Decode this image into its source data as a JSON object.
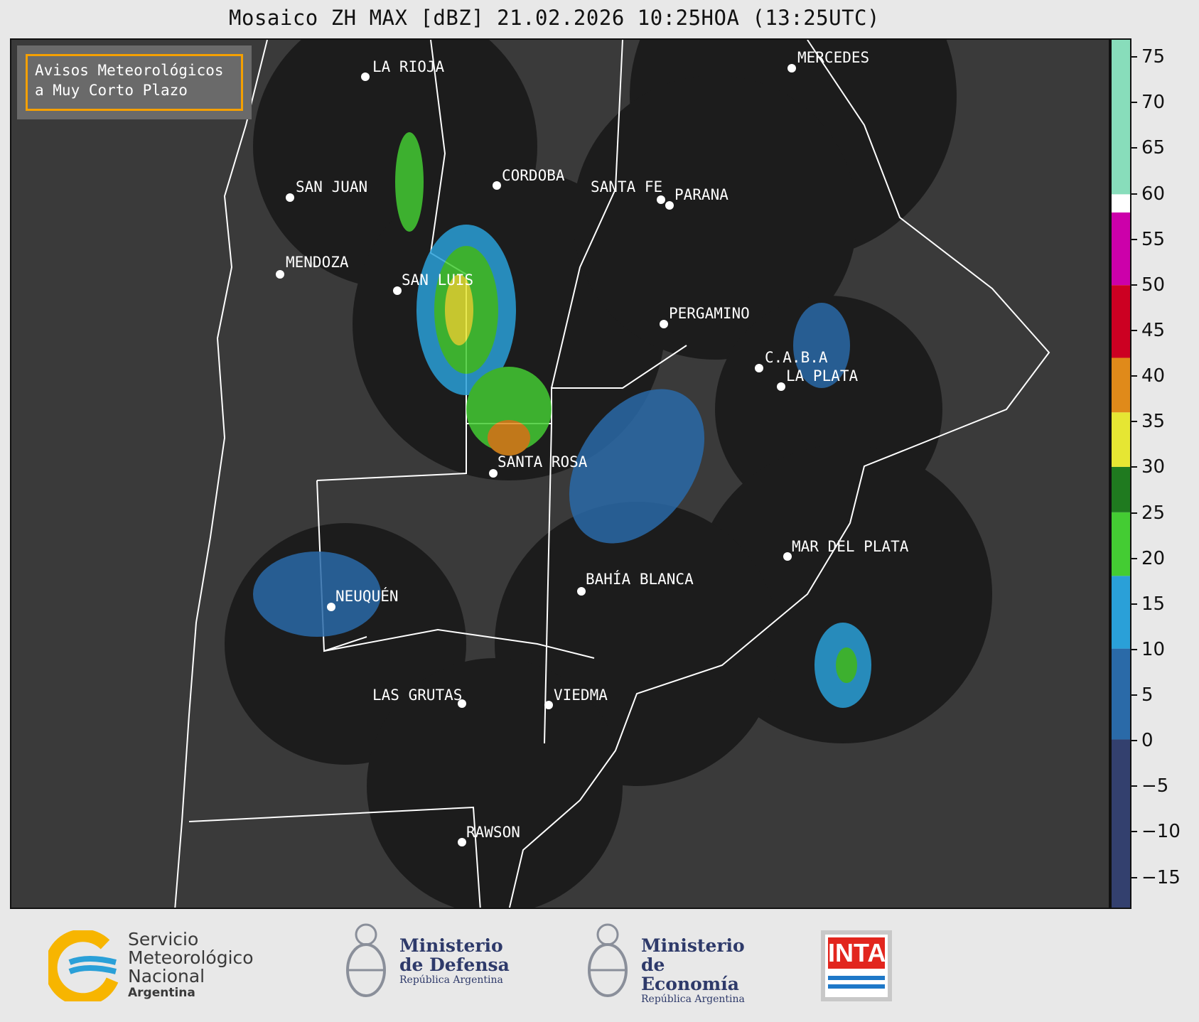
{
  "title": "Mosaico ZH MAX [dBZ] 21.02.2026 10:25HOA (13:25UTC)",
  "notice": {
    "line1": "Avisos Meteorológicos",
    "line2": "a Muy Corto Plazo"
  },
  "colors": {
    "accent_notice_border": "#f5a000",
    "radar_coverage": "#1c1c1c",
    "background": "#3a3a3a"
  },
  "cities": [
    {
      "name": "LA RIOJA"
    },
    {
      "name": "CORDOBA"
    },
    {
      "name": "SAN JUAN"
    },
    {
      "name": "SANTA FE"
    },
    {
      "name": "PARANA"
    },
    {
      "name": "MENDOZA"
    },
    {
      "name": "SAN LUIS"
    },
    {
      "name": "PERGAMINO"
    },
    {
      "name": "C.A.B.A"
    },
    {
      "name": "LA PLATA"
    },
    {
      "name": "MERCEDES"
    },
    {
      "name": "SANTA ROSA"
    },
    {
      "name": "MAR DEL PLATA"
    },
    {
      "name": "NEUQUÉN"
    },
    {
      "name": "BAHÍA BLANCA"
    },
    {
      "name": "LAS GRUTAS"
    },
    {
      "name": "VIEDMA"
    },
    {
      "name": "RAWSON"
    }
  ],
  "colorbar": {
    "min": -18.5,
    "max": 77.0,
    "ticks": [
      "75",
      "70",
      "65",
      "60",
      "55",
      "50",
      "45",
      "40",
      "35",
      "30",
      "25",
      "20",
      "15",
      "10",
      "5",
      "0",
      "−5",
      "−10",
      "−15"
    ],
    "tick_values": [
      75,
      70,
      65,
      60,
      55,
      50,
      45,
      40,
      35,
      30,
      25,
      20,
      15,
      10,
      5,
      0,
      -5,
      -10,
      -15
    ],
    "bands": [
      {
        "from": -18.5,
        "to": 0,
        "color": "#33406e"
      },
      {
        "from": 0,
        "to": 10,
        "color": "#2a6aa8"
      },
      {
        "from": 10,
        "to": 18,
        "color": "#2aa0d8"
      },
      {
        "from": 18,
        "to": 25,
        "color": "#44cc33"
      },
      {
        "from": 25,
        "to": 30,
        "color": "#1f7a1f"
      },
      {
        "from": 30,
        "to": 36,
        "color": "#e6e633"
      },
      {
        "from": 36,
        "to": 42,
        "color": "#e08a1a"
      },
      {
        "from": 42,
        "to": 50,
        "color": "#cc0022"
      },
      {
        "from": 50,
        "to": 58,
        "color": "#cc00aa"
      },
      {
        "from": 58,
        "to": 60,
        "color": "#ffffff"
      },
      {
        "from": 60,
        "to": 77,
        "color": "#88ddbb"
      }
    ]
  },
  "logos": {
    "smn": {
      "line1": "Servicio",
      "line2": "Meteorológico",
      "line3": "Nacional",
      "line4": "Argentina"
    },
    "defensa": {
      "line1": "Ministerio",
      "line2": "de Defensa",
      "line3": "República Argentina"
    },
    "economia": {
      "line1": "Ministerio",
      "line2": "de Economía",
      "line3": "República Argentina"
    },
    "inta": {
      "label": "INTA"
    }
  }
}
